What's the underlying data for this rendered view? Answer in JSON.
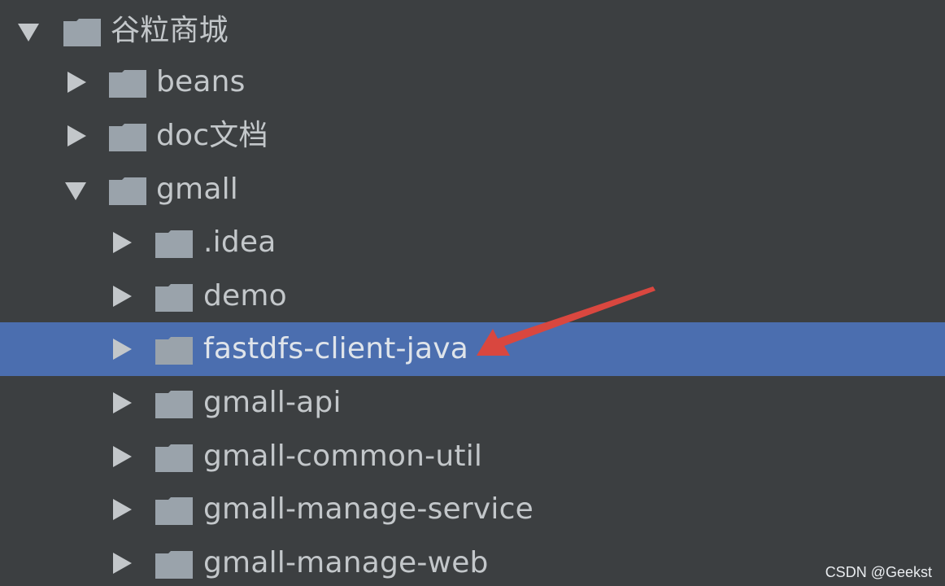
{
  "tree": {
    "rows": [
      {
        "label": "谷粒商城",
        "expanded": true,
        "level": 0,
        "icon": "folder-icon",
        "arrow": "chevron-down-icon"
      },
      {
        "label": "beans",
        "expanded": false,
        "level": 1,
        "icon": "folder-icon",
        "arrow": "chevron-right-icon"
      },
      {
        "label": "doc文档",
        "expanded": false,
        "level": 1,
        "icon": "folder-icon",
        "arrow": "chevron-right-icon"
      },
      {
        "label": "gmall",
        "expanded": true,
        "level": 1,
        "icon": "folder-icon",
        "arrow": "chevron-down-icon"
      },
      {
        "label": ".idea",
        "expanded": false,
        "level": 2,
        "icon": "folder-icon",
        "arrow": "chevron-right-icon"
      },
      {
        "label": "demo",
        "expanded": false,
        "level": 2,
        "icon": "folder-icon",
        "arrow": "chevron-right-icon"
      },
      {
        "label": "fastdfs-client-java",
        "expanded": false,
        "level": 2,
        "selected": true,
        "icon": "folder-icon",
        "arrow": "chevron-right-icon"
      },
      {
        "label": "gmall-api",
        "expanded": false,
        "level": 2,
        "icon": "folder-icon",
        "arrow": "chevron-right-icon"
      },
      {
        "label": "gmall-common-util",
        "expanded": false,
        "level": 2,
        "icon": "folder-icon",
        "arrow": "chevron-right-icon"
      },
      {
        "label": "gmall-manage-service",
        "expanded": false,
        "level": 2,
        "icon": "folder-icon",
        "arrow": "chevron-right-icon"
      },
      {
        "label": "gmall-manage-web",
        "expanded": false,
        "level": 2,
        "icon": "folder-icon",
        "arrow": "chevron-right-icon"
      }
    ]
  },
  "watermark": "CSDN @Geekst",
  "colors": {
    "background": "#3c3f41",
    "selection": "#4b6eaf",
    "text": "#c3c7ca",
    "folder": "#9aa3ab",
    "annotation_arrow": "#d9473f"
  }
}
